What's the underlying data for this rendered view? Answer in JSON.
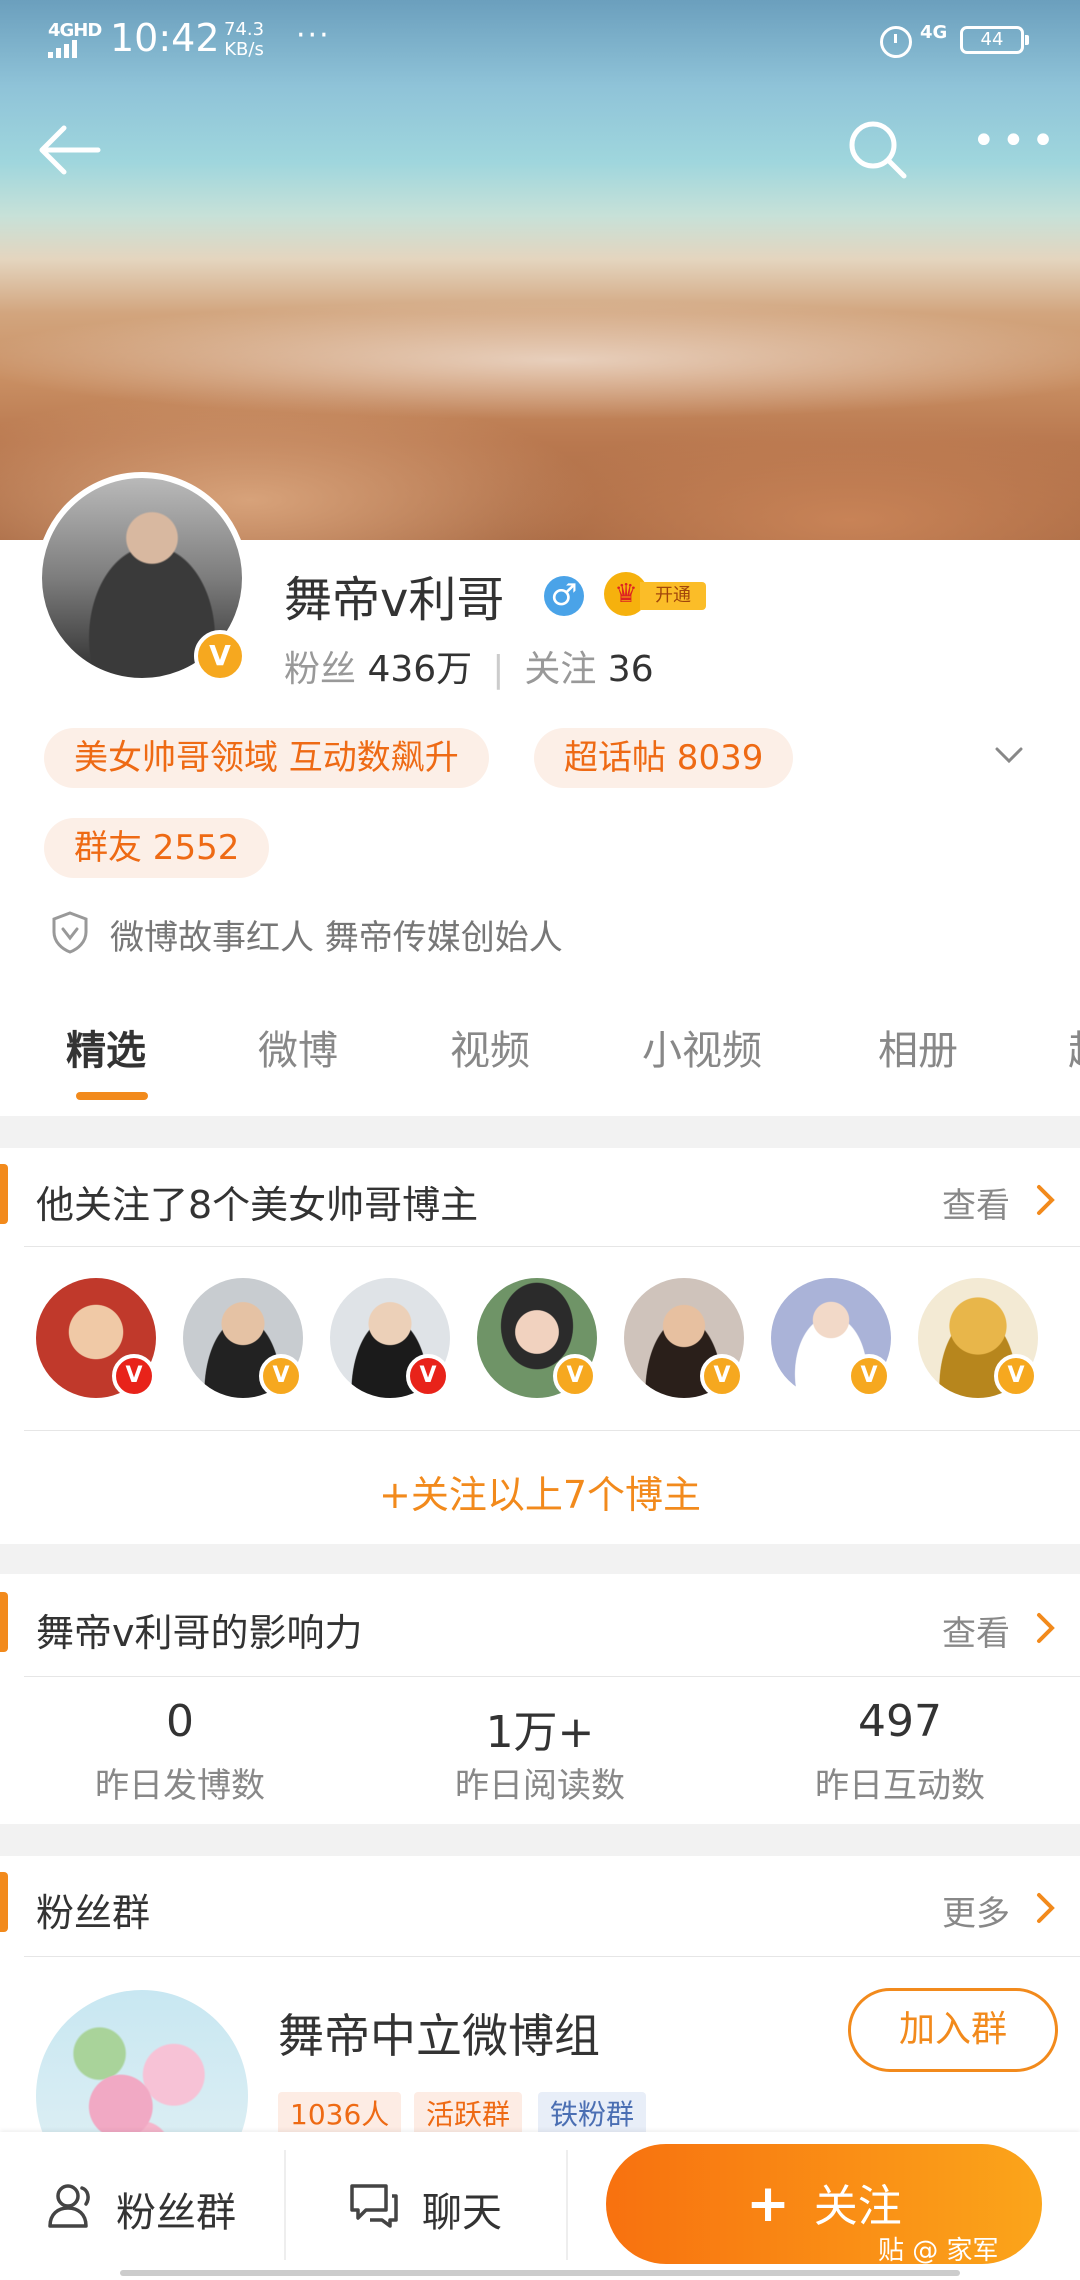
{
  "status_bar": {
    "network": "4GHD",
    "time": "10:42",
    "speed_value": "74.3",
    "speed_unit": "KB/s",
    "more": "···",
    "signal_right": "4G",
    "battery": "44"
  },
  "profile": {
    "name": "舞帝v利哥",
    "gender_symbol": "♂",
    "vip_label": "开通",
    "fans_label": "粉丝",
    "fans_value": "436万",
    "following_label": "关注",
    "following_value": "36",
    "tags": [
      "美女帅哥领域 互动数飙升",
      "超话帖 8039",
      "群友 2552"
    ],
    "verify_text": "微博故事红人 舞帝传媒创始人"
  },
  "tabs": [
    "精选",
    "微博",
    "视频",
    "小视频",
    "相册",
    "超"
  ],
  "following_section": {
    "title": "他关注了8个美女帅哥博主",
    "view": "查看",
    "follow_all": "+关注以上7个博主",
    "avatars": [
      {
        "name": "cartoon-avatar",
        "color": "#c0392b",
        "badge": "red"
      },
      {
        "name": "man-avatar-2",
        "color": "#9aa3ab",
        "badge": "gold"
      },
      {
        "name": "man-avatar-3",
        "color": "#c9cdd2",
        "badge": "red"
      },
      {
        "name": "woman-avatar-4",
        "color": "#5d7f5a",
        "badge": "gold"
      },
      {
        "name": "man-avatar-5",
        "color": "#7b5e50",
        "badge": "gold"
      },
      {
        "name": "woman-avatar-6",
        "color": "#c5cbe8",
        "badge": "gold"
      },
      {
        "name": "statue-avatar-7",
        "color": "#c9a236",
        "badge": "gold"
      }
    ]
  },
  "influence_section": {
    "title": "舞帝v利哥的影响力",
    "view": "查看",
    "stats": [
      {
        "value": "0",
        "label": "昨日发博数"
      },
      {
        "value": "1万+",
        "label": "昨日阅读数"
      },
      {
        "value": "497",
        "label": "昨日互动数"
      }
    ]
  },
  "fan_group_section": {
    "title": "粉丝群",
    "more": "更多",
    "group_name": "舞帝中立微博组",
    "tags": [
      "1036人",
      "活跃群",
      "铁粉群"
    ],
    "join": "加入群"
  },
  "bottom_bar": {
    "fans_group": "粉丝群",
    "chat": "聊天",
    "follow": "关注",
    "watermark": "贴 @ 家军"
  },
  "colors": {
    "accent": "#f28a1c",
    "tag_bg": "#fcefe7",
    "tag_text": "#ee6a14",
    "verified_gold": "#f6a81f",
    "gender_blue": "#4aa3e8"
  }
}
